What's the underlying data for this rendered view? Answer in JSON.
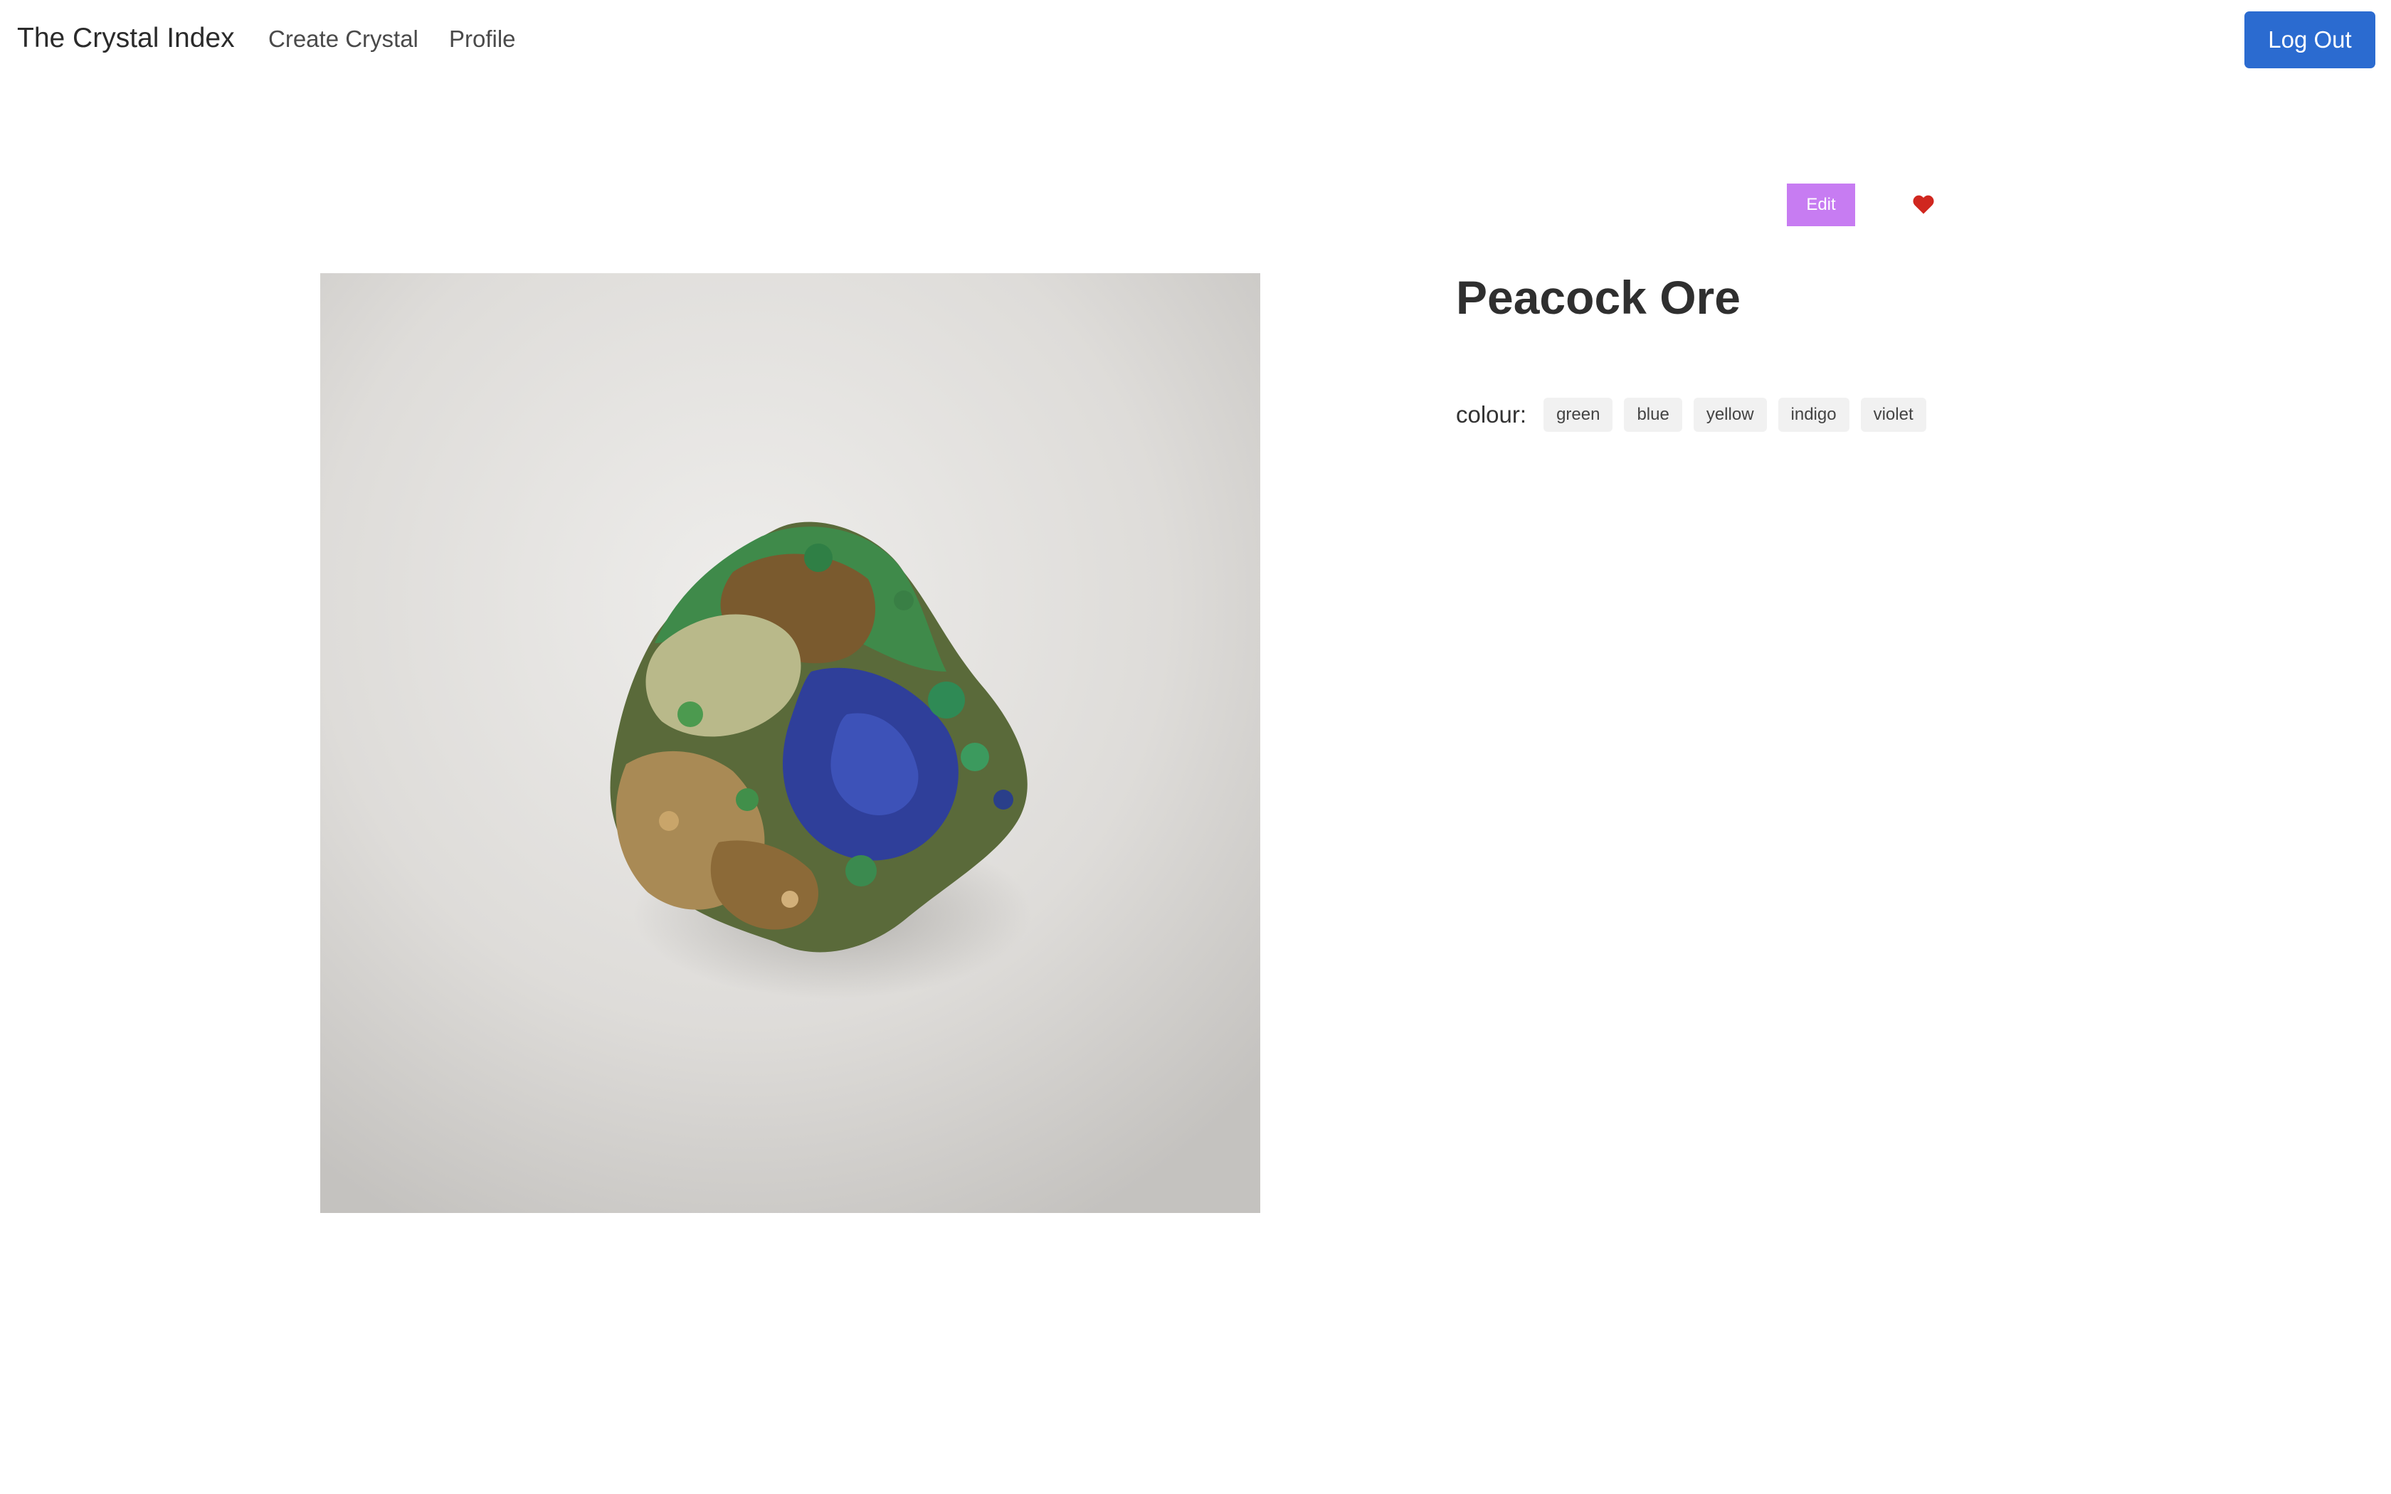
{
  "navbar": {
    "brand": "The Crystal Index",
    "links": [
      "Create Crystal",
      "Profile"
    ],
    "logout_label": "Log Out"
  },
  "actions": {
    "edit_label": "Edit",
    "favorite_icon": "heart-icon",
    "favorite_color": "#d0271f"
  },
  "crystal": {
    "name": "Peacock Ore",
    "colour_label": "colour:",
    "colours": [
      "green",
      "blue",
      "yellow",
      "indigo",
      "violet"
    ]
  },
  "colors": {
    "primary": "#2b6bd0",
    "edit": "#c77cf2"
  }
}
